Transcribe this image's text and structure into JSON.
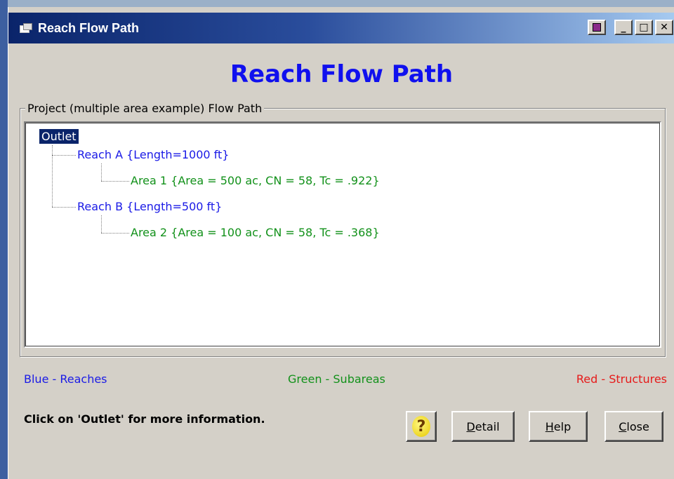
{
  "window": {
    "title": "Reach Flow Path"
  },
  "heading": "Reach Flow Path",
  "group": {
    "label": "Project (multiple area example) Flow Path"
  },
  "tree": {
    "root": "Outlet",
    "nodes": [
      {
        "label": "Reach A  {Length=1000 ft}",
        "kind": "reach"
      },
      {
        "label": "Area 1  {Area = 500 ac, CN = 58, Tc = .922}",
        "kind": "area"
      },
      {
        "label": "Reach B  {Length=500 ft}",
        "kind": "reach"
      },
      {
        "label": "Area 2  {Area = 100 ac, CN = 58, Tc = .368}",
        "kind": "area"
      }
    ]
  },
  "legend": {
    "reaches": {
      "text": "Blue - Reaches",
      "color": "#1a1ae6"
    },
    "subareas": {
      "text": "Green - Subareas",
      "color": "#12911a"
    },
    "structures": {
      "text": "Red - Structures",
      "color": "#e61a1a"
    }
  },
  "message": "Click on 'Outlet' for more information.",
  "buttons": {
    "help_icon": "?",
    "detail_first": "D",
    "detail_rest": "etail",
    "help_first": "H",
    "help_rest": "elp",
    "close_first": "C",
    "close_rest": "lose"
  },
  "titlebar_buttons": {
    "extra": "▪",
    "minimize": "_",
    "maximize": "□",
    "close": "✕"
  },
  "icons": {
    "app": "window-app-icon",
    "help": "question-mark-icon"
  }
}
